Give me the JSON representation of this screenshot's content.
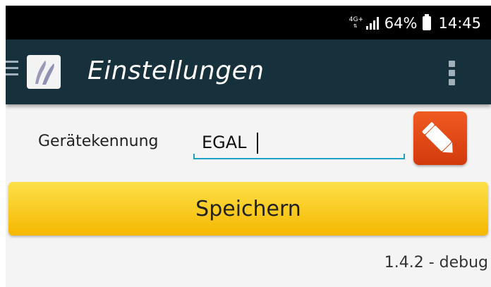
{
  "status_bar": {
    "network": "4G+",
    "battery_percent": "64%",
    "time": "14:45"
  },
  "app_bar": {
    "title": "Einstellungen"
  },
  "form": {
    "device_id_label": "Gerätekennung",
    "device_id_value": "EGAL"
  },
  "save_button": {
    "label": "Speichern"
  },
  "version": "1.4.2 - debug",
  "icons": [
    "menu-icon",
    "app-logo-icon",
    "overflow-menu-icon",
    "pencil-icon",
    "signal-icon",
    "battery-icon"
  ],
  "colors": {
    "app_bar": "#16303c",
    "accent_input": "#1da1c4",
    "edit_button": "#e24a16",
    "save_button": "#f9c913"
  }
}
